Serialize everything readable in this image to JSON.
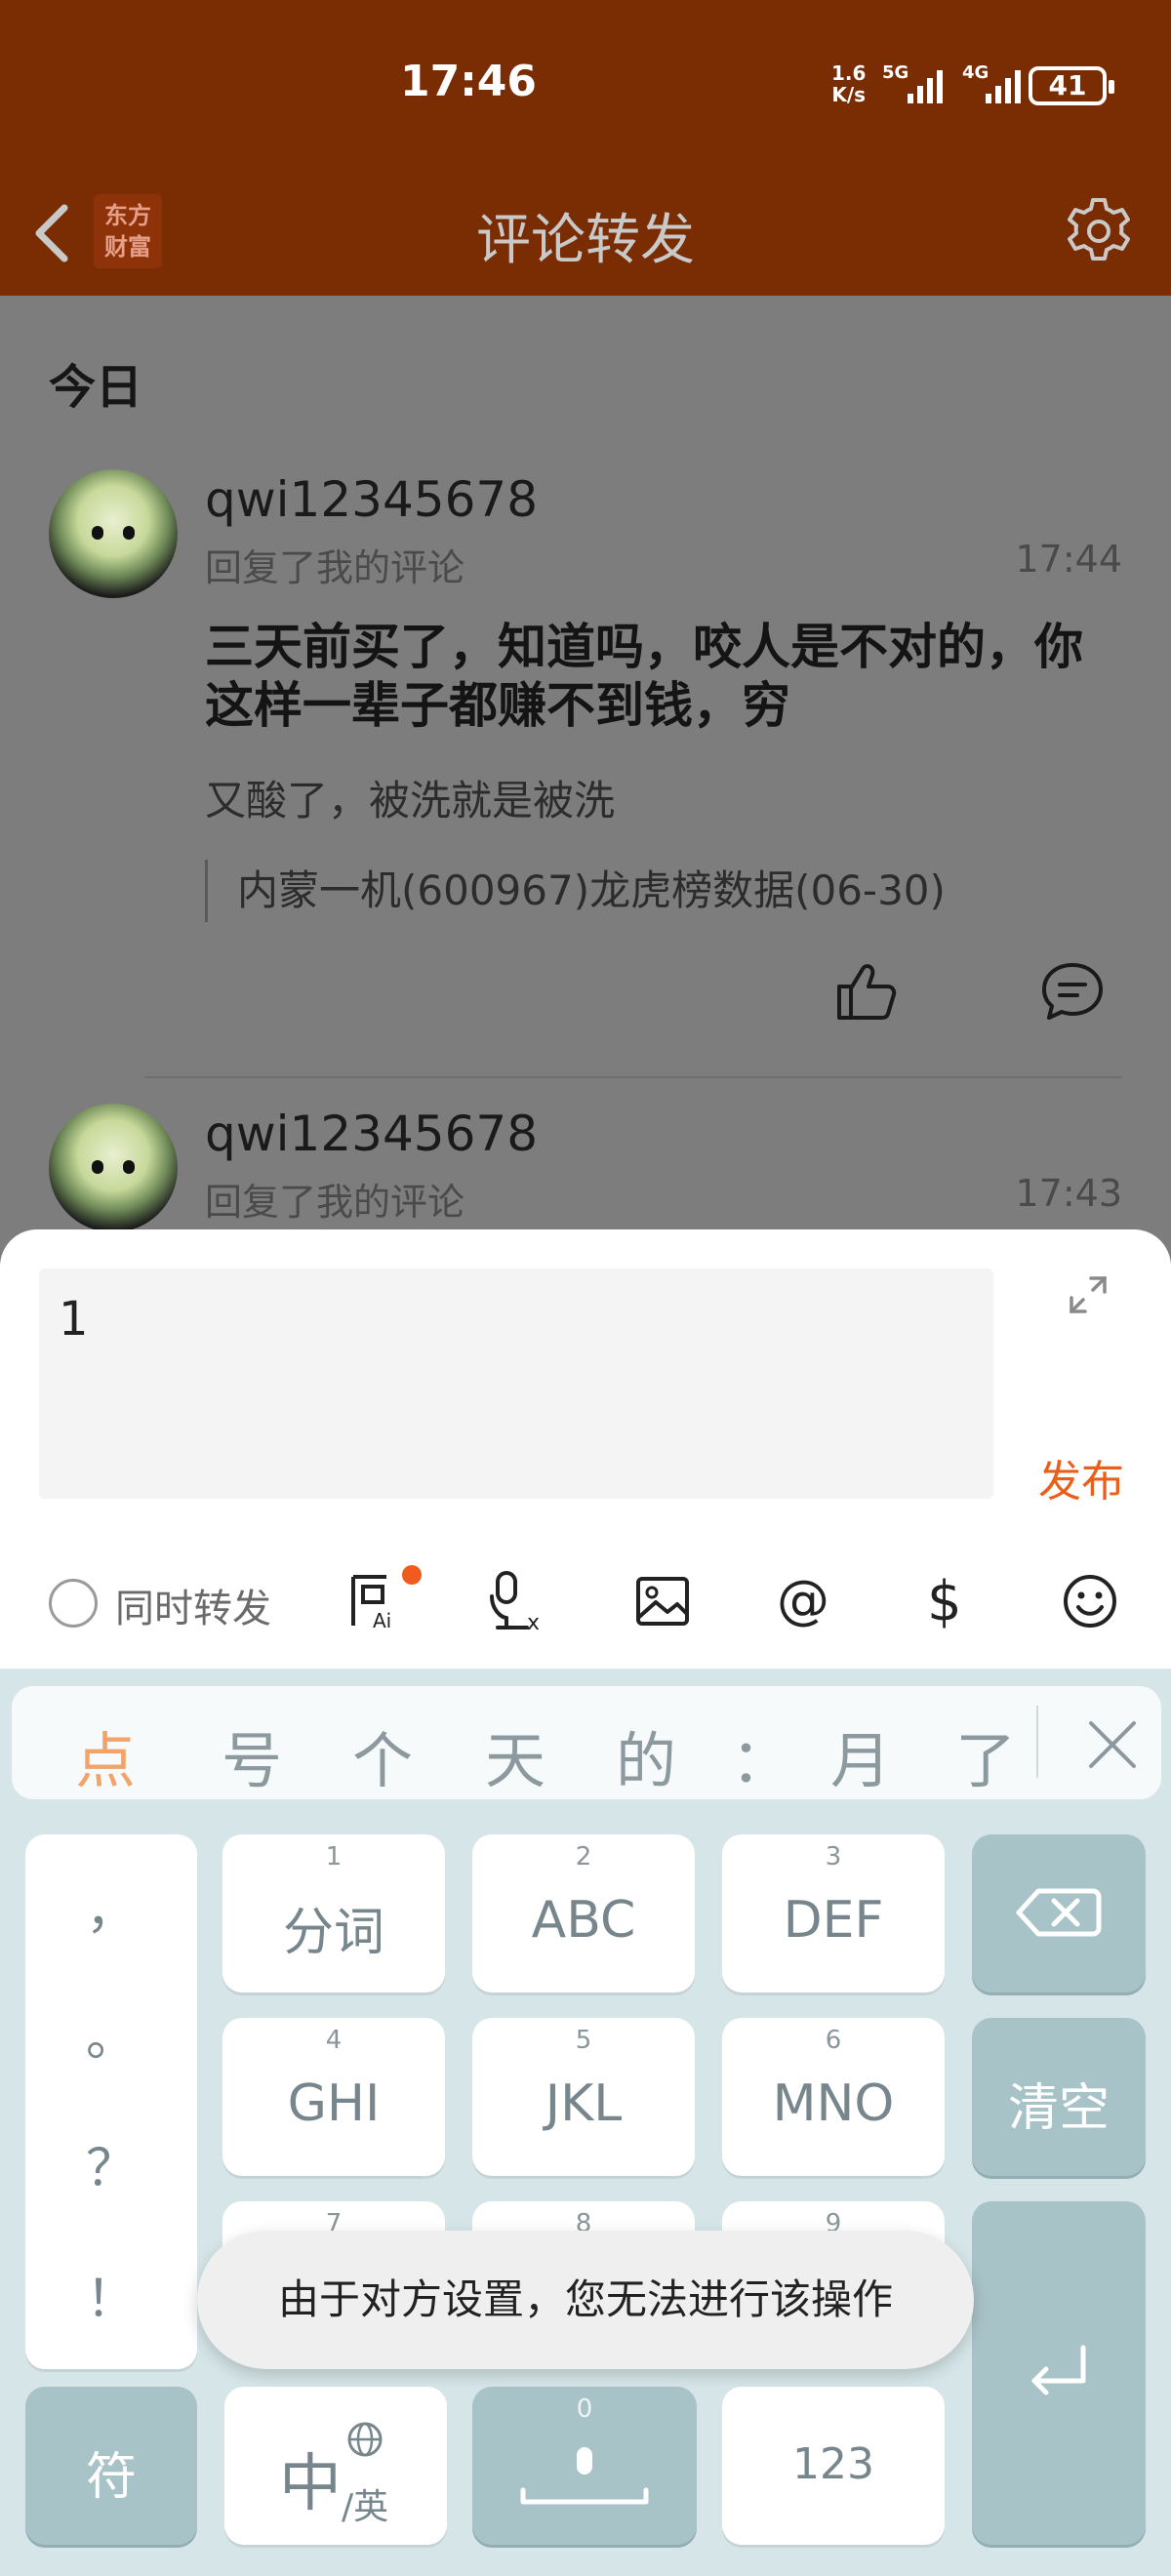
{
  "status": {
    "time": "17:46",
    "speed_top": "1.6",
    "speed_bottom": "K/s",
    "sig1": "5G",
    "sig2": "4G",
    "battery": "41"
  },
  "header": {
    "logo_line1": "东方",
    "logo_line2": "财富",
    "title": "评论转发"
  },
  "feed": {
    "section": "今日",
    "items": [
      {
        "username": "qwi12345678",
        "subtitle": "回复了我的评论",
        "time": "17:44",
        "comment": "三天前买了，知道吗，咬人是不对的，你这样一辈子都赚不到钱，穷",
        "reply": "又酸了，被洗就是被洗",
        "quote": "内蒙一机(600967)龙虎榜数据(06-30)"
      },
      {
        "username": "qwi12345678",
        "subtitle": "回复了我的评论",
        "time": "17:43"
      }
    ]
  },
  "compose": {
    "value": "1",
    "publish": "发布",
    "forward_label": "同时转发"
  },
  "keyboard": {
    "candidates": [
      "点",
      "号",
      "个",
      "天",
      "的",
      "：",
      "月",
      "了"
    ],
    "punct": [
      "，",
      "。",
      "？",
      "！"
    ],
    "keys": [
      {
        "num": "1",
        "label": "分词"
      },
      {
        "num": "2",
        "label": "ABC"
      },
      {
        "num": "3",
        "label": "DEF"
      },
      {
        "num": "4",
        "label": "GHI"
      },
      {
        "num": "5",
        "label": "JKL"
      },
      {
        "num": "6",
        "label": "MNO"
      },
      {
        "num": "7",
        "label": ""
      },
      {
        "num": "8",
        "label": ""
      },
      {
        "num": "9",
        "label": ""
      }
    ],
    "clear": "清空",
    "symbols": "符",
    "lang_main": "中",
    "lang_sub": "/英",
    "space_num": "0",
    "num_mode": "123"
  },
  "toast": "由于对方设置，您无法进行该操作"
}
